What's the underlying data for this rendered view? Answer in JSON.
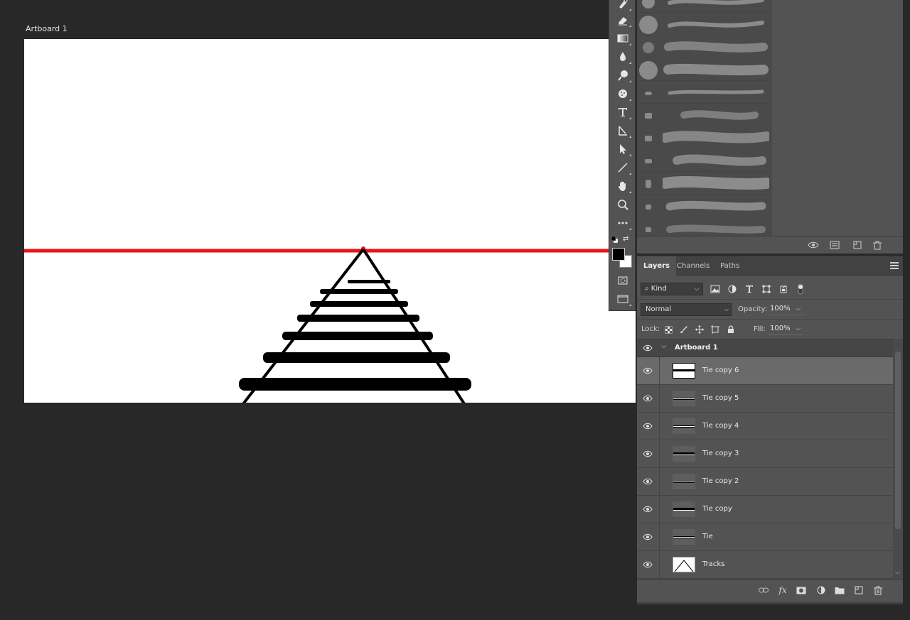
{
  "canvas": {
    "artboard_label": "Artboard 1"
  },
  "colors": {
    "foreground": "#000000",
    "background": "#ffffff",
    "horizon_line": "#e8141a",
    "ui_panel": "#535353",
    "app_background": "#282828"
  },
  "toolbar": {
    "tools": [
      "spot-healing-brush-icon",
      "eraser-icon",
      "gradient-icon",
      "blur-icon",
      "dodge-icon",
      "sponge-icon",
      "type-icon",
      "path-selection-icon",
      "direct-selection-icon",
      "line-icon",
      "hand-icon",
      "zoom-icon",
      "more-tools-icon",
      "quick-mask-icon",
      "screen-mode-icon"
    ]
  },
  "layers_panel": {
    "tabs": [
      "Layers",
      "Channels",
      "Paths"
    ],
    "active_tab": "Layers",
    "filter_kind": "Kind",
    "blend_mode": "Normal",
    "opacity_label": "Opacity:",
    "opacity_value": "100%",
    "lock_label": "Lock:",
    "fill_label": "Fill:",
    "fill_value": "100%",
    "artboard_group": "Artboard 1",
    "layers": [
      {
        "name": "Tie copy 6",
        "selected": true
      },
      {
        "name": "Tie copy 5",
        "selected": false
      },
      {
        "name": "Tie copy 4",
        "selected": false
      },
      {
        "name": "Tie copy 3",
        "selected": false
      },
      {
        "name": "Tie copy 2",
        "selected": false
      },
      {
        "name": "Tie copy",
        "selected": false
      },
      {
        "name": "Tie",
        "selected": false
      },
      {
        "name": "Tracks",
        "selected": false
      }
    ]
  }
}
